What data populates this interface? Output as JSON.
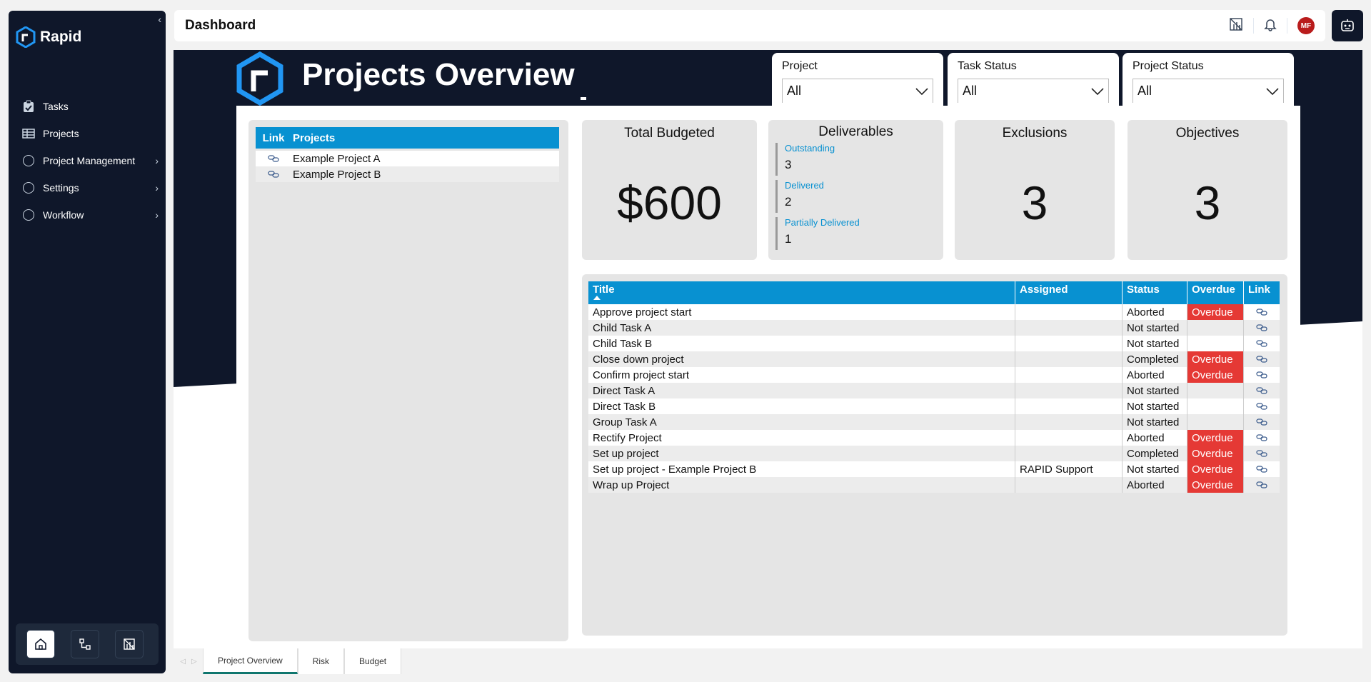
{
  "app": {
    "name": "Rapid",
    "page_title": "Dashboard"
  },
  "sidebar": {
    "items": [
      {
        "label": "Tasks",
        "icon": "clipboard-icon"
      },
      {
        "label": "Projects",
        "icon": "grid-table-icon"
      },
      {
        "label": "Project Management",
        "icon": "circle-icon",
        "expandable": true
      },
      {
        "label": "Settings",
        "icon": "circle-icon",
        "expandable": true
      },
      {
        "label": "Workflow",
        "icon": "circle-icon",
        "expandable": true
      }
    ],
    "bottom": [
      "home-icon",
      "workflow-icon",
      "report-icon"
    ]
  },
  "header": {
    "avatar_initials": "MF"
  },
  "report": {
    "title": "Projects Overview",
    "slicers": [
      {
        "label": "Project",
        "value": "All"
      },
      {
        "label": "Task Status",
        "value": "All"
      },
      {
        "label": "Project Status",
        "value": "All"
      }
    ],
    "projects_table": {
      "headers": [
        "Link",
        "Projects"
      ],
      "rows": [
        "Example Project A",
        "Example Project B"
      ]
    },
    "kpis": {
      "total_budgeted": {
        "title": "Total Budgeted",
        "value": "$600"
      },
      "deliverables": {
        "title": "Deliverables",
        "items": [
          {
            "label": "Outstanding",
            "value": "3"
          },
          {
            "label": "Delivered",
            "value": "2"
          },
          {
            "label": "Partially Delivered",
            "value": "1"
          }
        ]
      },
      "exclusions": {
        "title": "Exclusions",
        "value": "3"
      },
      "objectives": {
        "title": "Objectives",
        "value": "3"
      }
    },
    "tasks_table": {
      "headers": [
        "Title",
        "Assigned",
        "Status",
        "Overdue",
        "Link"
      ],
      "rows": [
        {
          "title": "Approve project start",
          "assigned": "",
          "status": "Aborted",
          "overdue": "Overdue"
        },
        {
          "title": "Child Task A",
          "assigned": "",
          "status": "Not started",
          "overdue": ""
        },
        {
          "title": "Child Task B",
          "assigned": "",
          "status": "Not started",
          "overdue": ""
        },
        {
          "title": "Close down project",
          "assigned": "",
          "status": "Completed",
          "overdue": "Overdue"
        },
        {
          "title": "Confirm project start",
          "assigned": "",
          "status": "Aborted",
          "overdue": "Overdue"
        },
        {
          "title": "Direct Task A",
          "assigned": "",
          "status": "Not started",
          "overdue": ""
        },
        {
          "title": "Direct Task B",
          "assigned": "",
          "status": "Not started",
          "overdue": ""
        },
        {
          "title": "Group Task A",
          "assigned": "",
          "status": "Not started",
          "overdue": ""
        },
        {
          "title": "Rectify Project",
          "assigned": "",
          "status": "Aborted",
          "overdue": "Overdue"
        },
        {
          "title": "Set up project",
          "assigned": "",
          "status": "Completed",
          "overdue": "Overdue"
        },
        {
          "title": "Set up project - Example Project B",
          "assigned": "RAPID Support",
          "status": "Not started",
          "overdue": "Overdue"
        },
        {
          "title": "Wrap up Project",
          "assigned": "",
          "status": "Aborted",
          "overdue": "Overdue"
        }
      ]
    }
  },
  "page_tabs": [
    {
      "label": "Project Overview",
      "active": true
    },
    {
      "label": "Risk",
      "active": false
    },
    {
      "label": "Budget",
      "active": false
    }
  ],
  "colors": {
    "navy": "#0f172a",
    "accent_blue": "#0891d1",
    "overdue_red": "#e53935",
    "active_tab": "#0f766e"
  }
}
